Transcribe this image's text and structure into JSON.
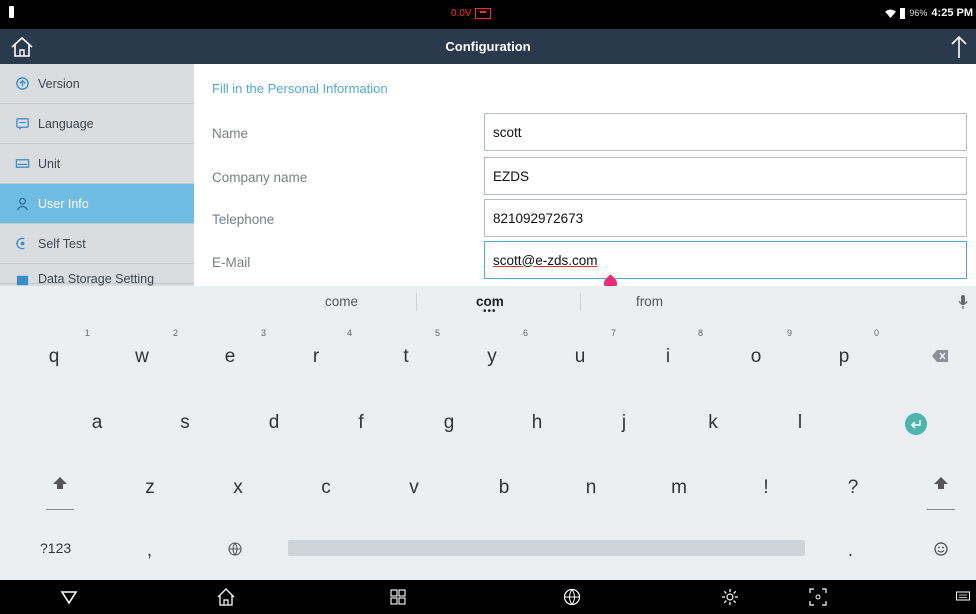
{
  "status_bar": {
    "voltage": "0.0V",
    "battery_percent": "96%",
    "time": "4:25 PM"
  },
  "title_bar": {
    "title": "Configuration"
  },
  "sidebar": {
    "items": [
      {
        "label": "Version",
        "icon": "version-icon"
      },
      {
        "label": "Language",
        "icon": "language-icon"
      },
      {
        "label": "Unit",
        "icon": "unit-icon"
      },
      {
        "label": "User Info",
        "icon": "user-icon",
        "active": true
      },
      {
        "label": "Self Test",
        "icon": "self-test-icon"
      },
      {
        "label": "Data Storage Setting",
        "icon": "storage-icon"
      }
    ]
  },
  "form": {
    "section_title": "Fill in the Personal Information",
    "fields": [
      {
        "label": "Name",
        "value": "scott"
      },
      {
        "label": "Company name",
        "value": "EZDS"
      },
      {
        "label": "Telephone",
        "value": "821092972673"
      },
      {
        "label": "E-Mail",
        "value": "scott@e-zds.com"
      }
    ]
  },
  "keyboard": {
    "suggestions": [
      "come",
      "com",
      "from"
    ],
    "row1": [
      "q",
      "w",
      "e",
      "r",
      "t",
      "y",
      "u",
      "i",
      "o",
      "p"
    ],
    "row1_hints": [
      "1",
      "2",
      "3",
      "4",
      "5",
      "6",
      "7",
      "8",
      "9",
      "0"
    ],
    "row2": [
      "a",
      "s",
      "d",
      "f",
      "g",
      "h",
      "j",
      "k",
      "l"
    ],
    "row3": [
      "z",
      "x",
      "c",
      "v",
      "b",
      "n",
      "m",
      "!",
      "?"
    ],
    "symbols_key": "?123",
    "comma_key": ",",
    "period_key": ".",
    "accent_color": "#4db6ac"
  },
  "colors": {
    "titlebar": "#2a3a4c",
    "sidebar_active": "#6fbde2",
    "section_title": "#4ea9d6"
  }
}
